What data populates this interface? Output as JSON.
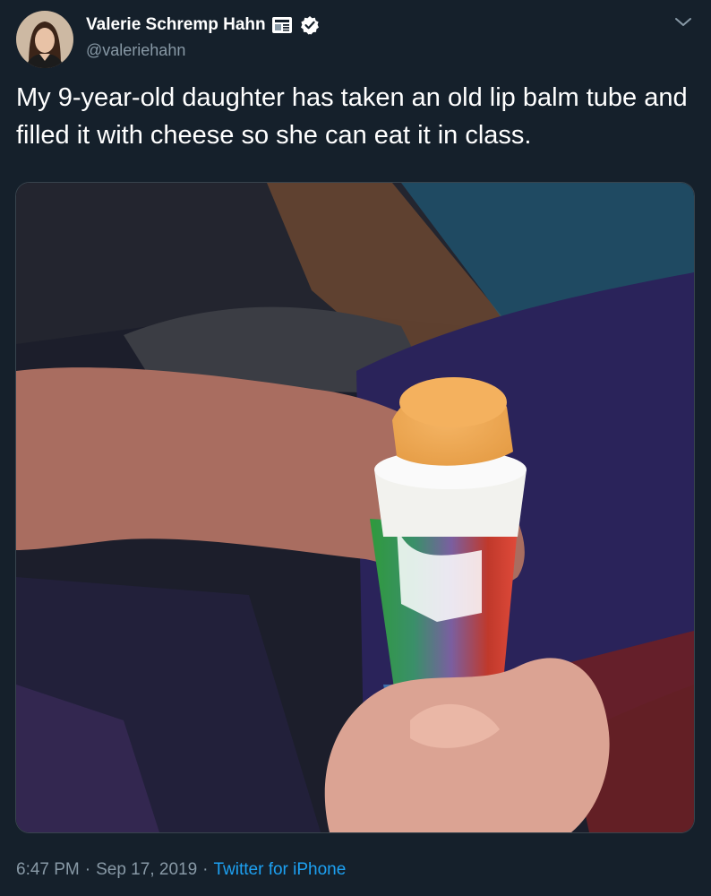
{
  "author": {
    "name": "Valerie Schremp Hahn",
    "handle": "@valeriehahn",
    "badges": [
      "newspaper-icon",
      "verified-icon"
    ]
  },
  "tweet": {
    "text": "My 9-year-old daughter has taken an old lip balm tube and filled it with cheese so she can eat it in class.",
    "media": "photo"
  },
  "meta": {
    "time": "6:47 PM",
    "separator1": "·",
    "date": "Sep 17, 2019",
    "separator2": "·",
    "source": "Twitter for iPhone"
  },
  "colors": {
    "background": "#15202b",
    "secondary_text": "#8899a6",
    "link": "#1da1f2",
    "verified": "#ffffff"
  }
}
